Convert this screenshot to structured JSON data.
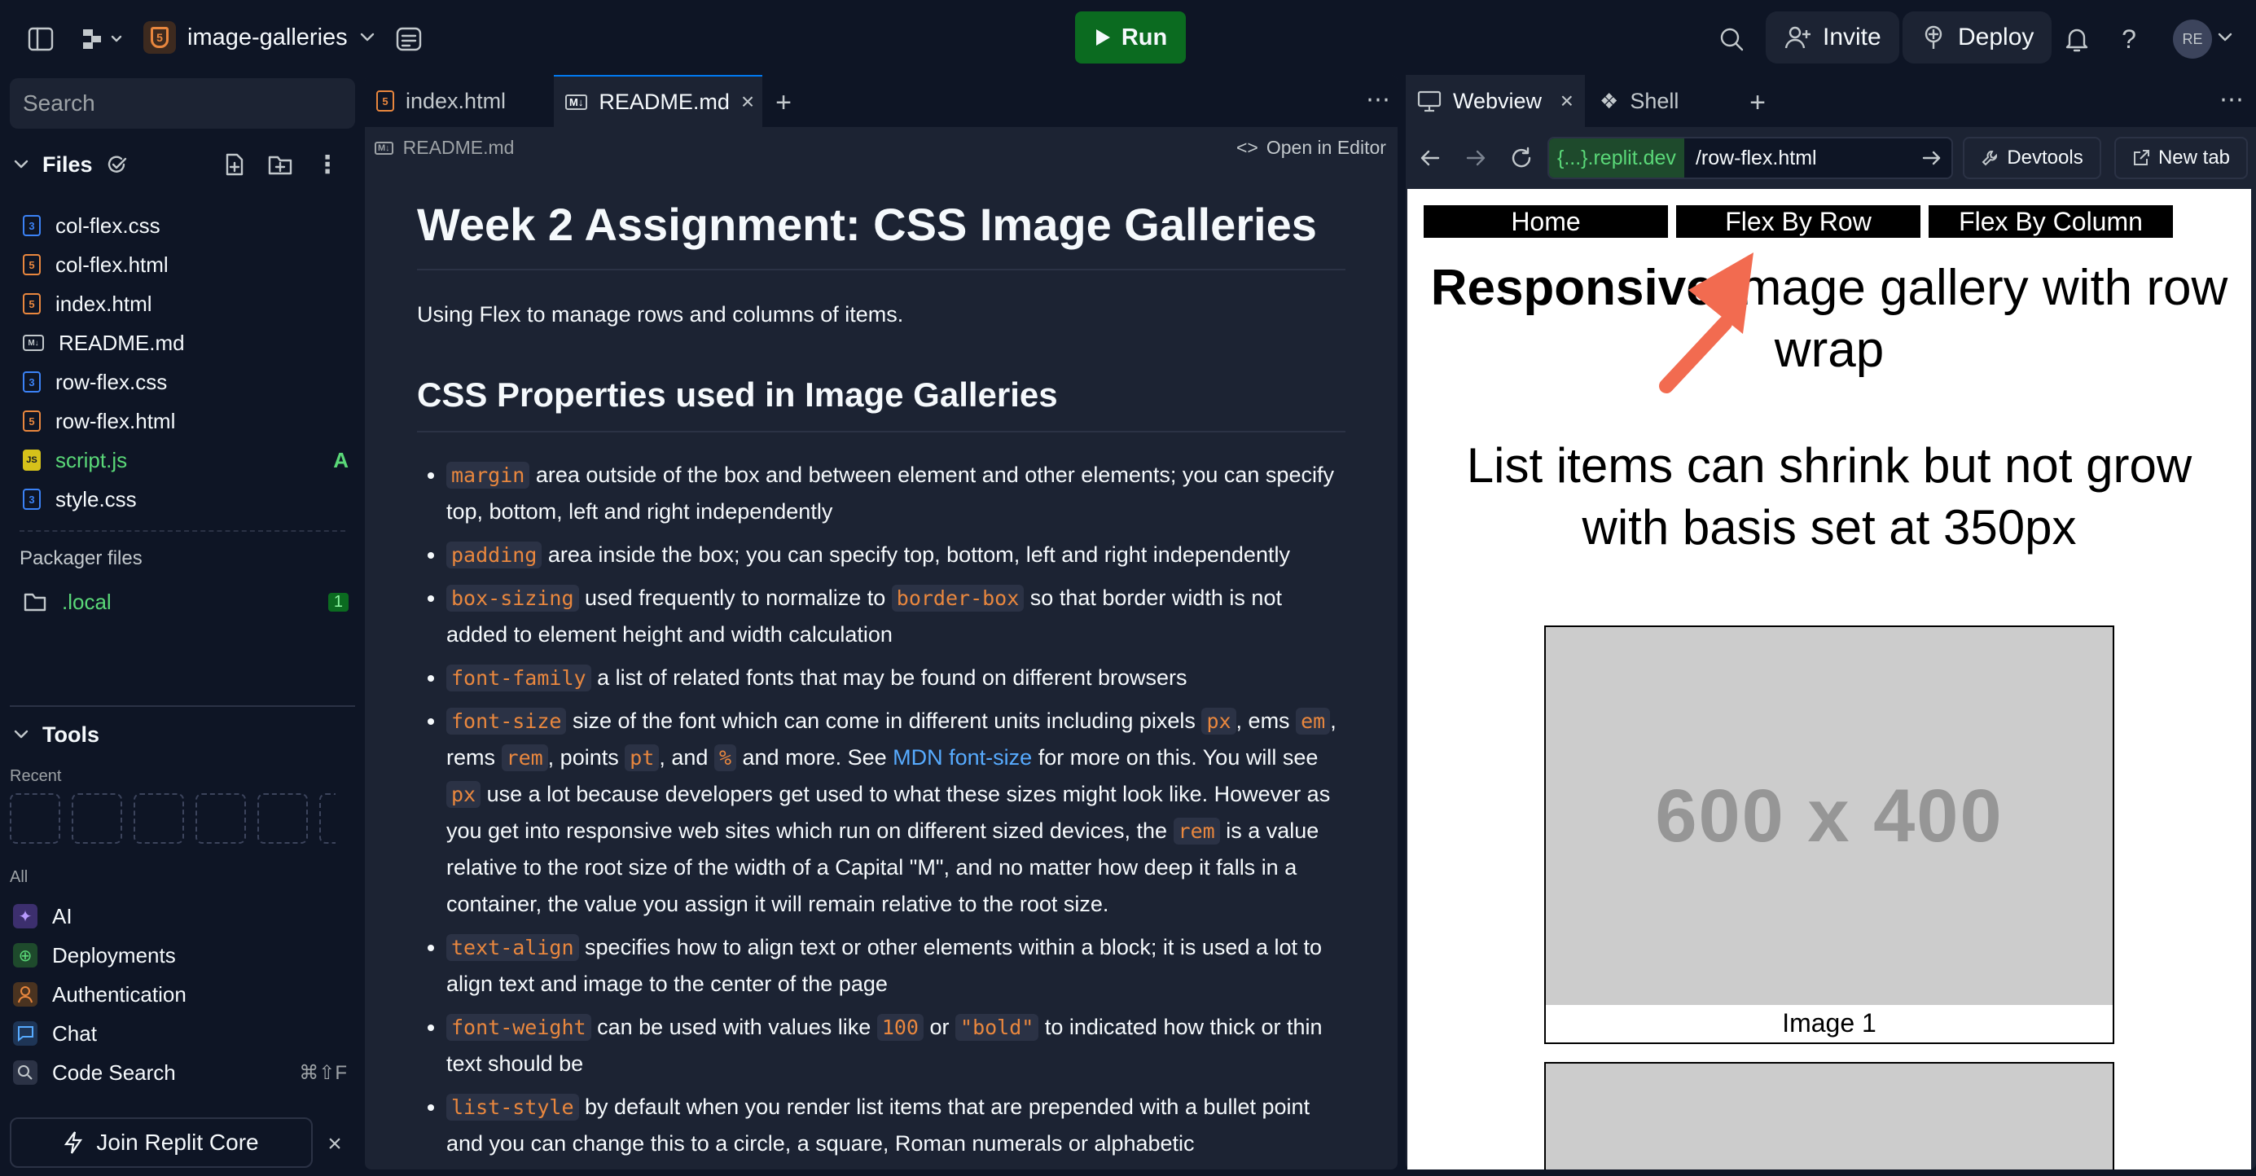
{
  "topbar": {
    "project_name": "image-galleries",
    "run_label": "Run",
    "invite_label": "Invite",
    "deploy_label": "Deploy",
    "avatar_initials": "RE"
  },
  "sidebar": {
    "search_placeholder": "Search",
    "files_title": "Files",
    "files": [
      {
        "name": "col-flex.css",
        "type": "css"
      },
      {
        "name": "col-flex.html",
        "type": "html"
      },
      {
        "name": "index.html",
        "type": "html"
      },
      {
        "name": "README.md",
        "type": "md"
      },
      {
        "name": "row-flex.css",
        "type": "css"
      },
      {
        "name": "row-flex.html",
        "type": "html"
      },
      {
        "name": "script.js",
        "type": "js",
        "badge": "A"
      },
      {
        "name": "style.css",
        "type": "css"
      }
    ],
    "packager_title": "Packager files",
    "packager_folder": ".local",
    "packager_badge": "1",
    "tools_title": "Tools",
    "recent_label": "Recent",
    "all_label": "All",
    "tools": [
      {
        "name": "AI"
      },
      {
        "name": "Deployments"
      },
      {
        "name": "Authentication"
      },
      {
        "name": "Chat"
      },
      {
        "name": "Code Search",
        "shortcut": "⌘⇧F"
      }
    ],
    "join_label": "Join Replit Core"
  },
  "editor": {
    "tabs": [
      "index.html",
      "README.md"
    ],
    "breadcrumb": "README.md",
    "open_in_editor": "Open in Editor",
    "h1": "Week 2 Assignment: CSS Image Galleries",
    "intro": "Using Flex to manage rows and columns of items.",
    "h2": "CSS Properties used in Image Galleries",
    "items": {
      "margin_code": "margin",
      "margin_text": "area outside of the box and between element and other elements; you can specify top, bottom, left and right independently",
      "padding_code": "padding",
      "padding_text": "area inside the box; you can specify top, bottom, left and right independently",
      "boxsizing_code": "box-sizing",
      "boxsizing_text1": "used frequently to normalize to",
      "boxsizing_code2": "border-box",
      "boxsizing_text2": "so that border width is not added to element height and width calculation",
      "fontfamily_code": "font-family",
      "fontfamily_text": "a list of related fonts that may be found on different browsers",
      "fontsize_code": "font-size",
      "fontsize_t1": "size of the font which can come in different units including pixels",
      "fontsize_px": "px",
      "fontsize_t2": ", ems",
      "fontsize_em": "em",
      "fontsize_t3": ", rems",
      "fontsize_rem": "rem",
      "fontsize_t4": ", points",
      "fontsize_pt": "pt",
      "fontsize_t5": ", and",
      "fontsize_pct": "%",
      "fontsize_t6": "and more. See",
      "fontsize_link": "MDN font-size",
      "fontsize_t7": "for more on this. You will see",
      "fontsize_px2": "px",
      "fontsize_t8": "use a lot because developers get used to what these sizes might look like. However as you get into responsive web sites which run on different sized devices, the",
      "fontsize_rem2": "rem",
      "fontsize_t9": "is a value relative to the root size of the width of a Capital \"M\", and no matter how deep it falls in a container, the value you assign it will remain relative to the root size.",
      "textalign_code": "text-align",
      "textalign_text": "specifies how to align text or other elements within a block; it is used a lot to align text and image to the center of the page",
      "fontweight_code": "font-weight",
      "fontweight_t1": "can be used with values like",
      "fontweight_100": "100",
      "fontweight_t2": "or",
      "fontweight_bold": "\"bold\"",
      "fontweight_t3": "to indicated how thick or thin text should be",
      "liststyle_code": "list-style",
      "liststyle_text": "by default when you render list items that are prepended with a bullet point and you can change this to a circle, a square, Roman numerals or alphabetic"
    }
  },
  "webview": {
    "tabs": [
      "Webview",
      "Shell"
    ],
    "domain": "{...}.replit.dev",
    "path": "/row-flex.html",
    "devtools_label": "Devtools",
    "newtab_label": "New tab",
    "nav": [
      "Home",
      "Flex By Row",
      "Flex By Column"
    ],
    "heading_bold": "Responsive",
    "heading_rest": "image gallery with row wrap",
    "subheading": "List items can shrink but not grow with basis set at 350px",
    "placeholder_text": "600 x 400",
    "caption1": "Image 1"
  },
  "colors": {
    "run_green": "#0b6b20",
    "accent_blue": "#57abff",
    "code_orange": "#e9873e",
    "arrow": "#f26b50"
  }
}
